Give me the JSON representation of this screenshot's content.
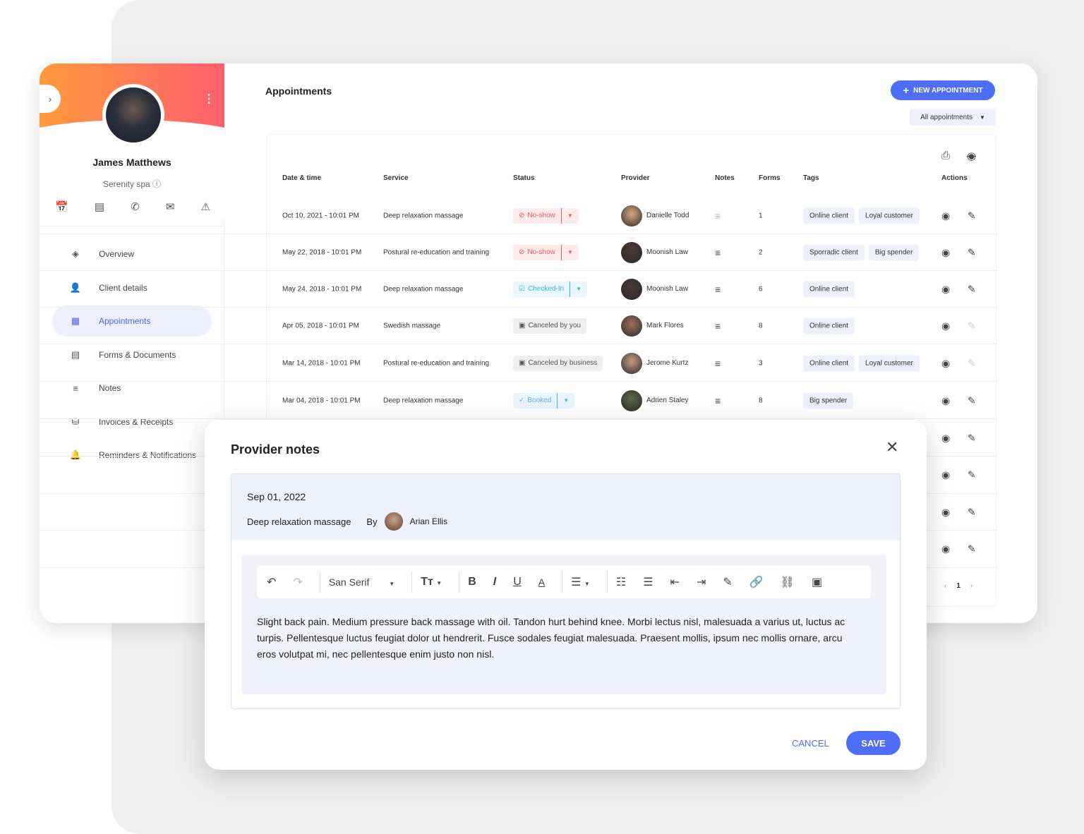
{
  "client": {
    "name": "James Matthews",
    "business": "Serenity spa"
  },
  "sidebar": {
    "items": [
      {
        "label": "Overview",
        "icon": "◈",
        "name": "layers"
      },
      {
        "label": "Client details",
        "icon": "👤",
        "name": "person"
      },
      {
        "label": "Appointments",
        "icon": "▦",
        "name": "calendar",
        "active": true
      },
      {
        "label": "Forms & Documents",
        "icon": "▤",
        "name": "clipboard"
      },
      {
        "label": "Notes",
        "icon": "≡",
        "name": "notes"
      },
      {
        "label": "Invoices & Receipts",
        "icon": "⛁",
        "name": "invoice"
      },
      {
        "label": "Reminders & Notifications",
        "icon": "🔔",
        "name": "bell"
      }
    ]
  },
  "page": {
    "title": "Appointments",
    "new_button": "NEW APPOINTMENT",
    "filter": "All appointments"
  },
  "table": {
    "headers": [
      "Date & time",
      "Service",
      "Status",
      "Provider",
      "Notes",
      "Forms",
      "Tags",
      "Actions"
    ],
    "rows": [
      {
        "date": "Oct 10, 2021 - 10:01 PM",
        "service": "Deep relaxation massage",
        "status": "No-show",
        "status_type": "noshow",
        "provider": "Danielle Todd",
        "forms": "1",
        "tags": [
          "Online client",
          "Loyal customer"
        ],
        "editable": true,
        "has_notes": false
      },
      {
        "date": "May 22, 2018 - 10:01 PM",
        "service": "Postural re-education and training",
        "status": "No-show",
        "status_type": "noshow",
        "provider": "Moonish Law",
        "forms": "2",
        "tags": [
          "Sporradic client",
          "Big spender"
        ],
        "editable": true,
        "has_notes": true
      },
      {
        "date": "May 24, 2018 - 10:01 PM",
        "service": "Deep relaxation massage",
        "status": "Checked-In",
        "status_type": "checked",
        "provider": "Moonish Law",
        "forms": "6",
        "tags": [
          "Online client"
        ],
        "editable": true,
        "has_notes": true
      },
      {
        "date": "Apr 05, 2018 - 10:01 PM",
        "service": "Swedish massage",
        "status": "Canceled by you",
        "status_type": "canceled",
        "provider": "Mark Flores",
        "forms": "8",
        "tags": [
          "Online client"
        ],
        "editable": false,
        "has_notes": true
      },
      {
        "date": "Mar 14, 2018 - 10:01 PM",
        "service": "Postural re-education and training",
        "status": "Canceled by business",
        "status_type": "canceled",
        "provider": "Jerome Kurtz",
        "forms": "3",
        "tags": [
          "Online client",
          "Loyal customer"
        ],
        "editable": false,
        "has_notes": true
      },
      {
        "date": "Mar 04, 2018 - 10:01 PM",
        "service": "Deep relaxation massage",
        "status": "Booked",
        "status_type": "booked",
        "provider": "Adrien Staley",
        "forms": "8",
        "tags": [
          "Big spender"
        ],
        "editable": true,
        "has_notes": true
      }
    ],
    "hidden_rows": 4,
    "page": "1"
  },
  "colors": {
    "accent": "#4f6ef7",
    "noshow": "#f05a5a",
    "checked": "#3ab0e8",
    "booked": "#5aaef0",
    "canceled": "#555555"
  },
  "modal": {
    "title": "Provider notes",
    "date": "Sep 01, 2022",
    "service": "Deep relaxation massage",
    "by": "By",
    "provider": "Arian Ellis",
    "font": "San Serif",
    "text": "Slight back pain. Medium pressure back massage with oil. Tandon hurt behind knee. Morbi lectus nisl, malesuada a varius ut, luctus ac turpis. Pellentesque luctus feugiat dolor ut hendrerit. Fusce sodales feugiat malesuada. Praesent mollis, ipsum nec mollis ornare, arcu eros volutpat mi, nec pellentesque enim justo non nisl.",
    "cancel": "CANCEL",
    "save": "SAVE"
  }
}
